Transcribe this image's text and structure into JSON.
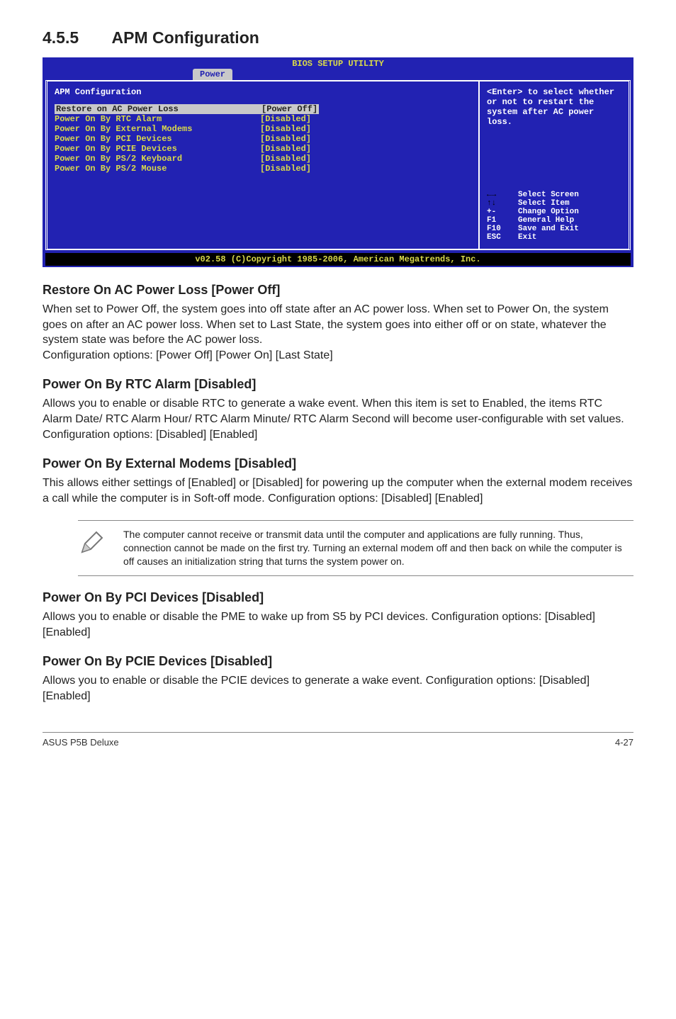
{
  "heading": {
    "number": "4.5.5",
    "title": "APM Configuration"
  },
  "bios": {
    "title": "BIOS SETUP UTILITY",
    "tab": "Power",
    "section_label": "APM Configuration",
    "rows": [
      {
        "name": "Restore on AC Power Loss",
        "val": "[Power Off]",
        "selected": true
      },
      {
        "name": "Power On By RTC Alarm",
        "val": "[Disabled]",
        "selected": false
      },
      {
        "name": "Power On By External Modems",
        "val": "[Disabled]",
        "selected": false
      },
      {
        "name": "Power On By PCI Devices",
        "val": "[Disabled]",
        "selected": false
      },
      {
        "name": "Power On By PCIE Devices",
        "val": "[Disabled]",
        "selected": false
      },
      {
        "name": "Power On By PS/2 Keyboard",
        "val": "[Disabled]",
        "selected": false
      },
      {
        "name": "Power On By PS/2 Mouse",
        "val": "[Disabled]",
        "selected": false
      }
    ],
    "help_text": "<Enter> to select whether or not to restart the system after AC power loss.",
    "keys": [
      {
        "k": "lr",
        "label": "Select Screen"
      },
      {
        "k": "ud",
        "label": "Select Item"
      },
      {
        "k": "+-",
        "label": "Change Option"
      },
      {
        "k": "F1",
        "label": "General Help"
      },
      {
        "k": "F10",
        "label": "Save and Exit"
      },
      {
        "k": "ESC",
        "label": "Exit"
      }
    ],
    "footer": "v02.58 (C)Copyright 1985-2006, American Megatrends, Inc."
  },
  "items": [
    {
      "heading": "Restore On AC Power Loss [Power Off]",
      "body": "When set to Power Off, the system goes into off state after an AC power loss. When set to Power On, the system goes on after an AC power loss. When set to Last State, the system goes into either off or on state, whatever the system state was before the AC power loss.\nConfiguration options: [Power Off] [Power On] [Last State]"
    },
    {
      "heading": "Power On By RTC Alarm [Disabled]",
      "body": "Allows you to enable or disable RTC to generate a wake event. When this item is set to Enabled, the items RTC Alarm Date/ RTC Alarm Hour/ RTC Alarm Minute/ RTC Alarm Second will become user-configurable with set values.\nConfiguration options: [Disabled] [Enabled]"
    },
    {
      "heading": "Power On By External Modems [Disabled]",
      "body": "This allows either settings of [Enabled] or [Disabled] for powering up the computer when the external modem receives a call while the computer is in Soft-off mode. Configuration options: [Disabled] [Enabled]"
    }
  ],
  "note": "The computer cannot receive or transmit data until the computer and applications are fully running. Thus, connection cannot be made on the first try. Turning an external modem off and then back on while the computer is off causes an initialization string that turns the system power on.",
  "items2": [
    {
      "heading": "Power On By PCI Devices [Disabled]",
      "body": "Allows you to enable or disable the PME to wake up from S5 by PCI devices. Configuration options: [Disabled] [Enabled]"
    },
    {
      "heading": "Power On By PCIE Devices [Disabled]",
      "body": "Allows you to enable or disable the PCIE devices to generate a wake event. Configuration options: [Disabled] [Enabled]"
    }
  ],
  "footer": {
    "left": "ASUS P5B Deluxe",
    "right": "4-27"
  }
}
